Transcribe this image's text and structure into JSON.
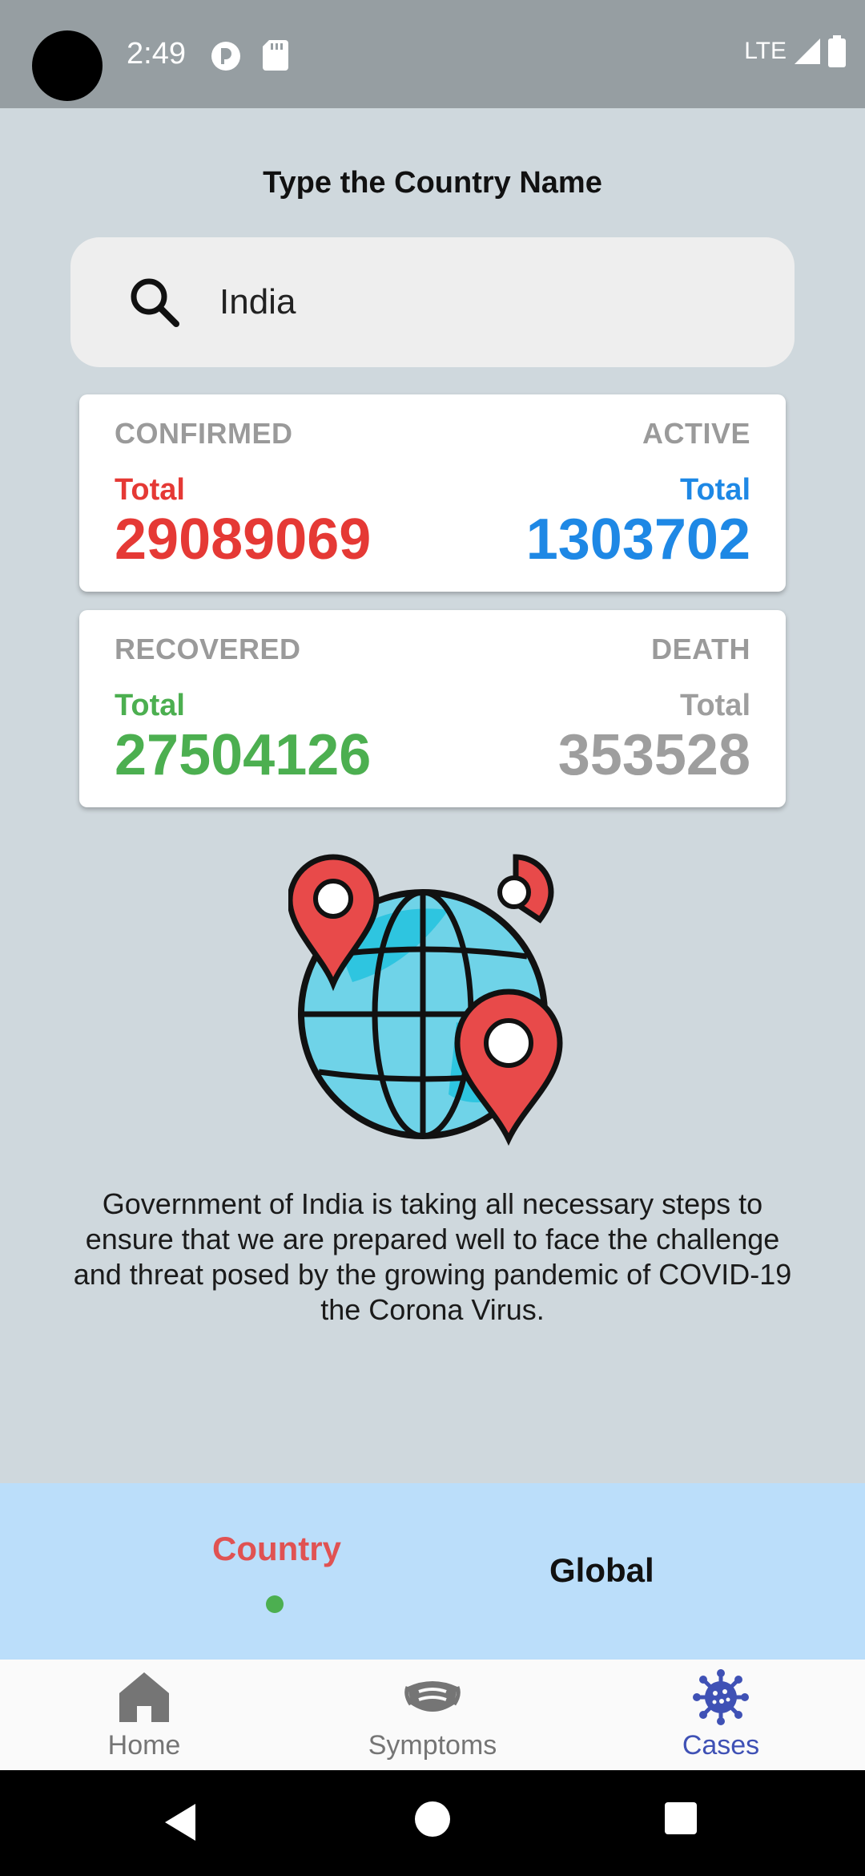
{
  "status_bar": {
    "time": "2:49",
    "network": "LTE"
  },
  "prompt": "Type the Country Name",
  "search": {
    "value": "India",
    "icon": "search-icon"
  },
  "stats": {
    "confirmed": {
      "title": "CONFIRMED",
      "sub": "Total",
      "value": "29089069",
      "color": "#e53935"
    },
    "active": {
      "title": "ACTIVE",
      "sub": "Total",
      "value": "1303702",
      "color": "#1e88e5"
    },
    "recovered": {
      "title": "RECOVERED",
      "sub": "Total",
      "value": "27504126",
      "color": "#4caf50"
    },
    "death": {
      "title": "DEATH",
      "sub": "Total",
      "value": "353528",
      "color": "#9e9e9e"
    }
  },
  "info_text": "Government of India is taking all necessary steps to ensure that we are prepared well to face the challenge and threat posed by the growing pandemic of COVID-19 the Corona Virus.",
  "tabs": {
    "country": "Country",
    "global": "Global",
    "active": "country"
  },
  "bottom_nav": [
    {
      "label": "Home",
      "icon": "home-icon"
    },
    {
      "label": "Symptoms",
      "icon": "mask-icon"
    },
    {
      "label": "Cases",
      "icon": "virus-icon",
      "active": true
    }
  ],
  "colors": {
    "accent": "#3f51b5",
    "tab_active": "#e05252",
    "tab_strip": "#bbdefa"
  }
}
